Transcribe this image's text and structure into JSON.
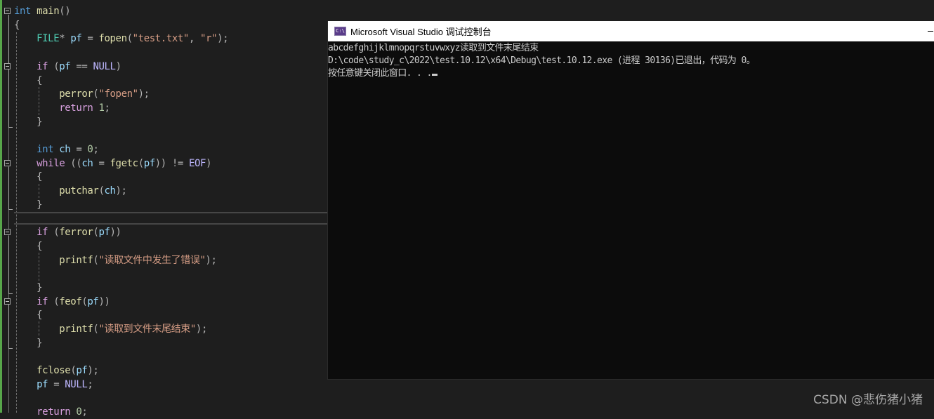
{
  "editor": {
    "lines": [
      {
        "tokens": [
          {
            "c": "kw",
            "t": "int"
          },
          {
            "c": "",
            "t": " "
          },
          {
            "c": "fn",
            "t": "main"
          },
          {
            "c": "pun",
            "t": "()"
          }
        ]
      },
      {
        "tokens": [
          {
            "c": "pun",
            "t": "{"
          }
        ]
      },
      {
        "tokens": [
          {
            "c": "",
            "t": "    "
          },
          {
            "c": "type",
            "t": "FILE"
          },
          {
            "c": "pun",
            "t": "* "
          },
          {
            "c": "var",
            "t": "pf"
          },
          {
            "c": "pun",
            "t": " = "
          },
          {
            "c": "fn",
            "t": "fopen"
          },
          {
            "c": "pun",
            "t": "("
          },
          {
            "c": "str",
            "t": "\"test.txt\""
          },
          {
            "c": "pun",
            "t": ", "
          },
          {
            "c": "str",
            "t": "\"r\""
          },
          {
            "c": "pun",
            "t": ");"
          }
        ]
      },
      {
        "tokens": []
      },
      {
        "tokens": [
          {
            "c": "",
            "t": "    "
          },
          {
            "c": "kw2",
            "t": "if"
          },
          {
            "c": "pun",
            "t": " ("
          },
          {
            "c": "var",
            "t": "pf"
          },
          {
            "c": "pun",
            "t": " == "
          },
          {
            "c": "mac",
            "t": "NULL"
          },
          {
            "c": "pun",
            "t": ")"
          }
        ]
      },
      {
        "tokens": [
          {
            "c": "",
            "t": "    "
          },
          {
            "c": "pun",
            "t": "{"
          }
        ]
      },
      {
        "tokens": [
          {
            "c": "",
            "t": "        "
          },
          {
            "c": "fn",
            "t": "perror"
          },
          {
            "c": "pun",
            "t": "("
          },
          {
            "c": "str",
            "t": "\"fopen\""
          },
          {
            "c": "pun",
            "t": ");"
          }
        ]
      },
      {
        "tokens": [
          {
            "c": "",
            "t": "        "
          },
          {
            "c": "kw2",
            "t": "return"
          },
          {
            "c": "pun",
            "t": " "
          },
          {
            "c": "num",
            "t": "1"
          },
          {
            "c": "pun",
            "t": ";"
          }
        ]
      },
      {
        "tokens": [
          {
            "c": "",
            "t": "    "
          },
          {
            "c": "pun",
            "t": "}"
          }
        ]
      },
      {
        "tokens": []
      },
      {
        "tokens": [
          {
            "c": "",
            "t": "    "
          },
          {
            "c": "kw",
            "t": "int"
          },
          {
            "c": "",
            "t": " "
          },
          {
            "c": "var",
            "t": "ch"
          },
          {
            "c": "pun",
            "t": " = "
          },
          {
            "c": "num",
            "t": "0"
          },
          {
            "c": "pun",
            "t": ";"
          }
        ]
      },
      {
        "tokens": [
          {
            "c": "",
            "t": "    "
          },
          {
            "c": "kw2",
            "t": "while"
          },
          {
            "c": "pun",
            "t": " (("
          },
          {
            "c": "var",
            "t": "ch"
          },
          {
            "c": "pun",
            "t": " = "
          },
          {
            "c": "fn",
            "t": "fgetc"
          },
          {
            "c": "pun",
            "t": "("
          },
          {
            "c": "var",
            "t": "pf"
          },
          {
            "c": "pun",
            "t": ")) != "
          },
          {
            "c": "mac",
            "t": "EOF"
          },
          {
            "c": "pun",
            "t": ")"
          }
        ]
      },
      {
        "tokens": [
          {
            "c": "",
            "t": "    "
          },
          {
            "c": "pun",
            "t": "{"
          }
        ]
      },
      {
        "tokens": [
          {
            "c": "",
            "t": "        "
          },
          {
            "c": "fn",
            "t": "putchar"
          },
          {
            "c": "pun",
            "t": "("
          },
          {
            "c": "var",
            "t": "ch"
          },
          {
            "c": "pun",
            "t": ");"
          }
        ]
      },
      {
        "tokens": [
          {
            "c": "",
            "t": "    "
          },
          {
            "c": "pun",
            "t": "}"
          }
        ]
      },
      {
        "tokens": []
      },
      {
        "tokens": [
          {
            "c": "",
            "t": "    "
          },
          {
            "c": "kw2",
            "t": "if"
          },
          {
            "c": "pun",
            "t": " ("
          },
          {
            "c": "fn",
            "t": "ferror"
          },
          {
            "c": "pun",
            "t": "("
          },
          {
            "c": "var",
            "t": "pf"
          },
          {
            "c": "pun",
            "t": "))"
          }
        ]
      },
      {
        "tokens": [
          {
            "c": "",
            "t": "    "
          },
          {
            "c": "pun",
            "t": "{"
          }
        ]
      },
      {
        "tokens": [
          {
            "c": "",
            "t": "        "
          },
          {
            "c": "fn",
            "t": "printf"
          },
          {
            "c": "pun",
            "t": "("
          },
          {
            "c": "str",
            "t": "\"读取文件中发生了错误\""
          },
          {
            "c": "pun",
            "t": ");"
          }
        ]
      },
      {
        "tokens": []
      },
      {
        "tokens": [
          {
            "c": "",
            "t": "    "
          },
          {
            "c": "pun",
            "t": "}"
          }
        ]
      },
      {
        "tokens": [
          {
            "c": "",
            "t": "    "
          },
          {
            "c": "kw2",
            "t": "if"
          },
          {
            "c": "pun",
            "t": " ("
          },
          {
            "c": "fn",
            "t": "feof"
          },
          {
            "c": "pun",
            "t": "("
          },
          {
            "c": "var",
            "t": "pf"
          },
          {
            "c": "pun",
            "t": "))"
          }
        ]
      },
      {
        "tokens": [
          {
            "c": "",
            "t": "    "
          },
          {
            "c": "pun",
            "t": "{"
          }
        ]
      },
      {
        "tokens": [
          {
            "c": "",
            "t": "        "
          },
          {
            "c": "fn",
            "t": "printf"
          },
          {
            "c": "pun",
            "t": "("
          },
          {
            "c": "str",
            "t": "\"读取到文件末尾结束\""
          },
          {
            "c": "pun",
            "t": ");"
          }
        ]
      },
      {
        "tokens": [
          {
            "c": "",
            "t": "    "
          },
          {
            "c": "pun",
            "t": "}"
          }
        ]
      },
      {
        "tokens": []
      },
      {
        "tokens": [
          {
            "c": "",
            "t": "    "
          },
          {
            "c": "fn",
            "t": "fclose"
          },
          {
            "c": "pun",
            "t": "("
          },
          {
            "c": "var",
            "t": "pf"
          },
          {
            "c": "pun",
            "t": ");"
          }
        ]
      },
      {
        "tokens": [
          {
            "c": "",
            "t": "    "
          },
          {
            "c": "var",
            "t": "pf"
          },
          {
            "c": "pun",
            "t": " = "
          },
          {
            "c": "mac",
            "t": "NULL"
          },
          {
            "c": "pun",
            "t": ";"
          }
        ]
      },
      {
        "tokens": []
      },
      {
        "tokens": [
          {
            "c": "",
            "t": "    "
          },
          {
            "c": "kw2",
            "t": "return"
          },
          {
            "c": "pun",
            "t": " "
          },
          {
            "c": "num",
            "t": "0"
          },
          {
            "c": "pun",
            "t": ";"
          }
        ]
      }
    ],
    "fold_markers": [
      0,
      4,
      11,
      16,
      21
    ]
  },
  "console": {
    "title": "Microsoft Visual Studio 调试控制台",
    "icon": "console-app-icon",
    "icon_text": "C:\\",
    "output_lines": [
      "abcdefghijklmnopqrstuvwxyz读取到文件末尾结束",
      "D:\\code\\study_c\\2022\\test.10.12\\x64\\Debug\\test.10.12.exe (进程 30136)已退出，代码为 0。",
      "按任意键关闭此窗口. . ."
    ]
  },
  "watermark": "CSDN @悲伤猪小猪"
}
